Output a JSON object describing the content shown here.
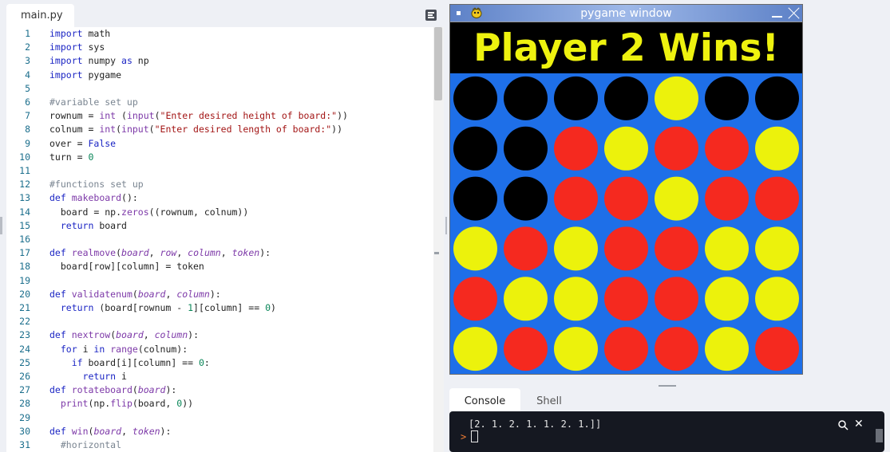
{
  "editor": {
    "file_tab": "main.py",
    "lines": [
      {
        "n": "1",
        "parts": [
          [
            "kw",
            "import"
          ],
          [
            "tx",
            " math"
          ]
        ]
      },
      {
        "n": "2",
        "parts": [
          [
            "kw",
            "import"
          ],
          [
            "tx",
            " sys"
          ]
        ]
      },
      {
        "n": "3",
        "parts": [
          [
            "kw",
            "import"
          ],
          [
            "tx",
            " numpy "
          ],
          [
            "kw",
            "as"
          ],
          [
            "tx",
            " np"
          ]
        ]
      },
      {
        "n": "4",
        "parts": [
          [
            "kw",
            "import"
          ],
          [
            "tx",
            " pygame"
          ]
        ]
      },
      {
        "n": "5",
        "parts": []
      },
      {
        "n": "6",
        "parts": [
          [
            "cm",
            "#variable set up"
          ]
        ]
      },
      {
        "n": "7",
        "parts": [
          [
            "tx",
            "rownum = "
          ],
          [
            "fn",
            "int"
          ],
          [
            "tx",
            " ("
          ],
          [
            "fn",
            "input"
          ],
          [
            "tx",
            "("
          ],
          [
            "st",
            "\"Enter desired height of board:\""
          ],
          [
            "tx",
            "))"
          ]
        ]
      },
      {
        "n": "8",
        "parts": [
          [
            "tx",
            "colnum = "
          ],
          [
            "fn",
            "int"
          ],
          [
            "tx",
            "("
          ],
          [
            "fn",
            "input"
          ],
          [
            "tx",
            "("
          ],
          [
            "st",
            "\"Enter desired length of board:\""
          ],
          [
            "tx",
            "))"
          ]
        ]
      },
      {
        "n": "9",
        "parts": [
          [
            "tx",
            "over = "
          ],
          [
            "kw",
            "False"
          ]
        ]
      },
      {
        "n": "10",
        "parts": [
          [
            "tx",
            "turn = "
          ],
          [
            "nu",
            "0"
          ]
        ]
      },
      {
        "n": "11",
        "parts": []
      },
      {
        "n": "12",
        "parts": [
          [
            "cm",
            "#functions set up"
          ]
        ]
      },
      {
        "n": "13",
        "parts": [
          [
            "kw",
            "def"
          ],
          [
            "tx",
            " "
          ],
          [
            "fn",
            "makeboard"
          ],
          [
            "tx",
            "():"
          ]
        ]
      },
      {
        "n": "14",
        "parts": [
          [
            "tx",
            "  board = np."
          ],
          [
            "fn",
            "zeros"
          ],
          [
            "tx",
            "((rownum, colnum))"
          ]
        ]
      },
      {
        "n": "15",
        "parts": [
          [
            "tx",
            "  "
          ],
          [
            "kw",
            "return"
          ],
          [
            "tx",
            " board"
          ]
        ]
      },
      {
        "n": "16",
        "parts": []
      },
      {
        "n": "17",
        "parts": [
          [
            "kw",
            "def"
          ],
          [
            "tx",
            " "
          ],
          [
            "fn",
            "realmove"
          ],
          [
            "tx",
            "("
          ],
          [
            "pa",
            "board"
          ],
          [
            "tx",
            ", "
          ],
          [
            "pa",
            "row"
          ],
          [
            "tx",
            ", "
          ],
          [
            "pa",
            "column"
          ],
          [
            "tx",
            ", "
          ],
          [
            "pa",
            "token"
          ],
          [
            "tx",
            "):"
          ]
        ]
      },
      {
        "n": "18",
        "parts": [
          [
            "tx",
            "  board[row][column] = token"
          ]
        ]
      },
      {
        "n": "19",
        "parts": []
      },
      {
        "n": "20",
        "parts": [
          [
            "kw",
            "def"
          ],
          [
            "tx",
            " "
          ],
          [
            "fn",
            "validatenum"
          ],
          [
            "tx",
            "("
          ],
          [
            "pa",
            "board"
          ],
          [
            "tx",
            ", "
          ],
          [
            "pa",
            "column"
          ],
          [
            "tx",
            "):"
          ]
        ]
      },
      {
        "n": "21",
        "parts": [
          [
            "tx",
            "  "
          ],
          [
            "kw",
            "return"
          ],
          [
            "tx",
            " (board[rownum - "
          ],
          [
            "nu",
            "1"
          ],
          [
            "tx",
            "][column] == "
          ],
          [
            "nu",
            "0"
          ],
          [
            "tx",
            ")"
          ]
        ]
      },
      {
        "n": "22",
        "parts": []
      },
      {
        "n": "23",
        "parts": [
          [
            "kw",
            "def"
          ],
          [
            "tx",
            " "
          ],
          [
            "fn",
            "nextrow"
          ],
          [
            "tx",
            "("
          ],
          [
            "pa",
            "board"
          ],
          [
            "tx",
            ", "
          ],
          [
            "pa",
            "column"
          ],
          [
            "tx",
            "):"
          ]
        ]
      },
      {
        "n": "24",
        "parts": [
          [
            "tx",
            "  "
          ],
          [
            "kw",
            "for"
          ],
          [
            "tx",
            " i "
          ],
          [
            "kw",
            "in"
          ],
          [
            "tx",
            " "
          ],
          [
            "fn",
            "range"
          ],
          [
            "tx",
            "(colnum):"
          ]
        ]
      },
      {
        "n": "25",
        "parts": [
          [
            "tx",
            "    "
          ],
          [
            "kw",
            "if"
          ],
          [
            "tx",
            " board[i][column] == "
          ],
          [
            "nu",
            "0"
          ],
          [
            "tx",
            ":"
          ]
        ]
      },
      {
        "n": "26",
        "parts": [
          [
            "tx",
            "      "
          ],
          [
            "kw",
            "return"
          ],
          [
            "tx",
            " i"
          ]
        ]
      },
      {
        "n": "27",
        "parts": [
          [
            "kw",
            "def"
          ],
          [
            "tx",
            " "
          ],
          [
            "fn",
            "rotateboard"
          ],
          [
            "tx",
            "("
          ],
          [
            "pa",
            "board"
          ],
          [
            "tx",
            "):"
          ]
        ]
      },
      {
        "n": "28",
        "parts": [
          [
            "tx",
            "  "
          ],
          [
            "fn",
            "print"
          ],
          [
            "tx",
            "(np."
          ],
          [
            "fn",
            "flip"
          ],
          [
            "tx",
            "(board, "
          ],
          [
            "nu",
            "0"
          ],
          [
            "tx",
            "))"
          ]
        ]
      },
      {
        "n": "29",
        "parts": []
      },
      {
        "n": "30",
        "parts": [
          [
            "kw",
            "def"
          ],
          [
            "tx",
            " "
          ],
          [
            "fn",
            "win"
          ],
          [
            "tx",
            "("
          ],
          [
            "pa",
            "board"
          ],
          [
            "tx",
            ", "
          ],
          [
            "pa",
            "token"
          ],
          [
            "tx",
            "):"
          ]
        ]
      },
      {
        "n": "31",
        "parts": [
          [
            "tx",
            "  "
          ],
          [
            "cm",
            "#horizontal"
          ]
        ]
      }
    ]
  },
  "pygame": {
    "window_title": "pygame window",
    "banner": "Player 2 Wins!",
    "board": [
      [
        "black",
        "black",
        "black",
        "black",
        "yellow",
        "black",
        "black"
      ],
      [
        "black",
        "black",
        "red",
        "yellow",
        "red",
        "red",
        "yellow"
      ],
      [
        "black",
        "black",
        "red",
        "red",
        "yellow",
        "red",
        "red"
      ],
      [
        "yellow",
        "red",
        "yellow",
        "red",
        "red",
        "yellow",
        "yellow"
      ],
      [
        "red",
        "yellow",
        "yellow",
        "red",
        "red",
        "yellow",
        "yellow"
      ],
      [
        "yellow",
        "red",
        "yellow",
        "red",
        "red",
        "yellow",
        "red"
      ]
    ],
    "colors": {
      "black": "#000000",
      "red": "#f5291f",
      "yellow": "#ecf20c",
      "board": "#1e6fe8",
      "banner_text": "#eef20f"
    }
  },
  "console_panel": {
    "tabs": [
      "Console",
      "Shell"
    ],
    "output": "[2. 1. 2. 1. 1. 2. 1.]]",
    "prompt": ">"
  }
}
